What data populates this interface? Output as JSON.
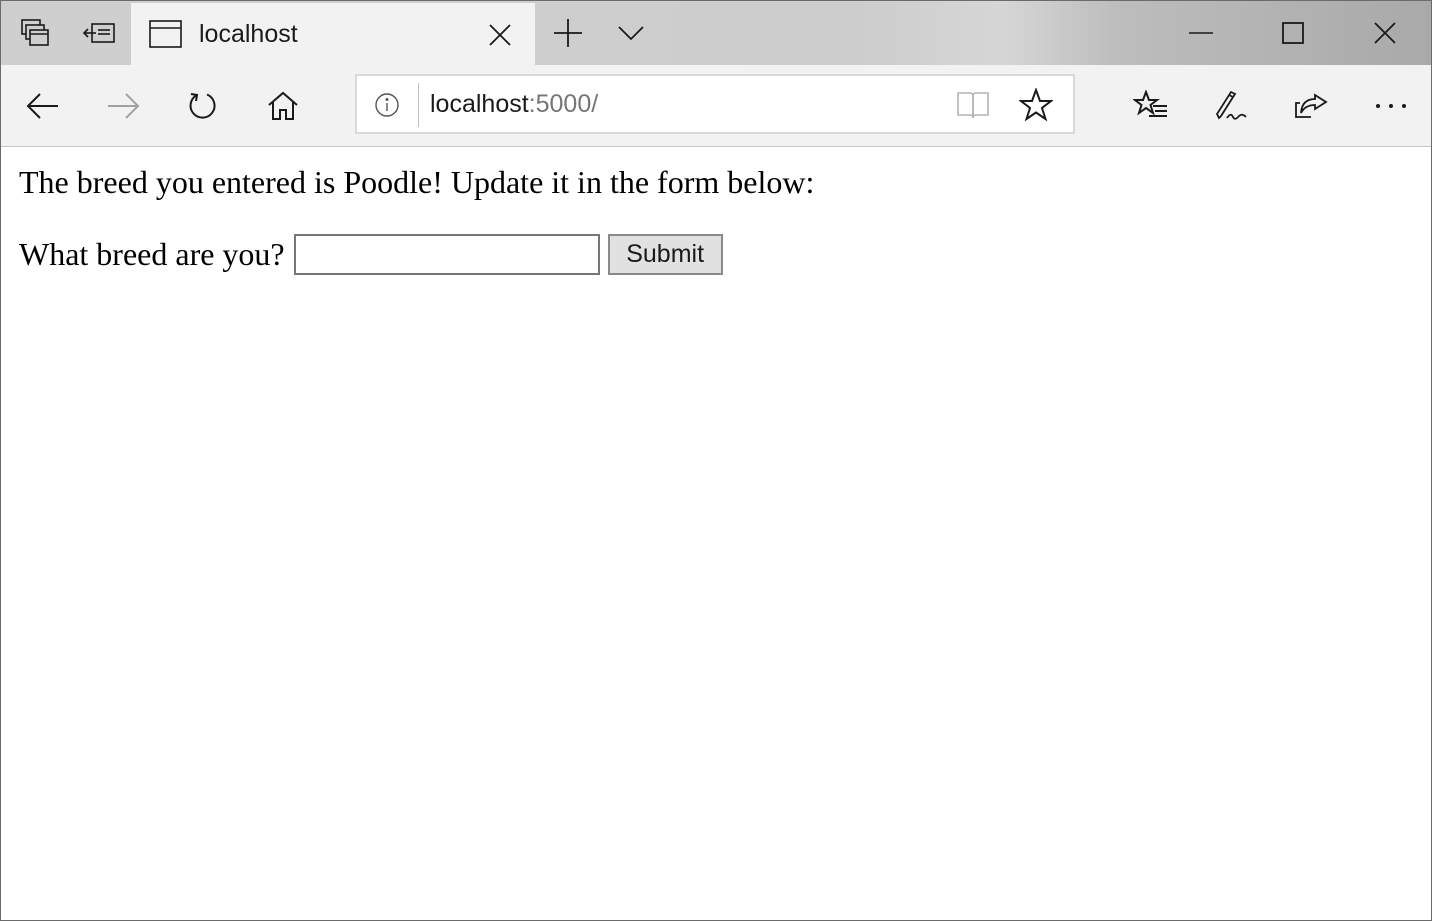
{
  "browser": {
    "tab": {
      "title": "localhost"
    },
    "address": {
      "host": "localhost",
      "rest": ":5000/"
    },
    "icons": {
      "set_tabs_aside": "tabs-aside-icon",
      "show_set_aside": "show-tabs-aside-icon",
      "page": "page-icon",
      "close_tab": "close-icon",
      "new_tab": "plus-icon",
      "tab_list": "chevron-down-icon",
      "minimize": "minimize-icon",
      "maximize": "maximize-icon",
      "close_window": "close-icon",
      "back": "back-arrow-icon",
      "forward": "forward-arrow-icon",
      "refresh": "refresh-icon",
      "home": "home-icon",
      "site_info": "info-icon",
      "reading_view": "book-icon",
      "add_favorite": "star-icon",
      "favorites": "favorites-list-icon",
      "web_note": "pen-icon",
      "share": "share-icon",
      "more": "more-icon"
    },
    "colors": {
      "chrome": "#f2f2f2",
      "titlebar": "#cdcdcd",
      "url_host": "#1a1a1a",
      "url_rest": "#767676",
      "forward_disabled": "#a0a0a0"
    }
  },
  "page": {
    "message": "The breed you entered is Poodle! Update it in the form below:",
    "form": {
      "label": "What breed are you?",
      "input_value": "",
      "submit_label": "Submit"
    }
  }
}
